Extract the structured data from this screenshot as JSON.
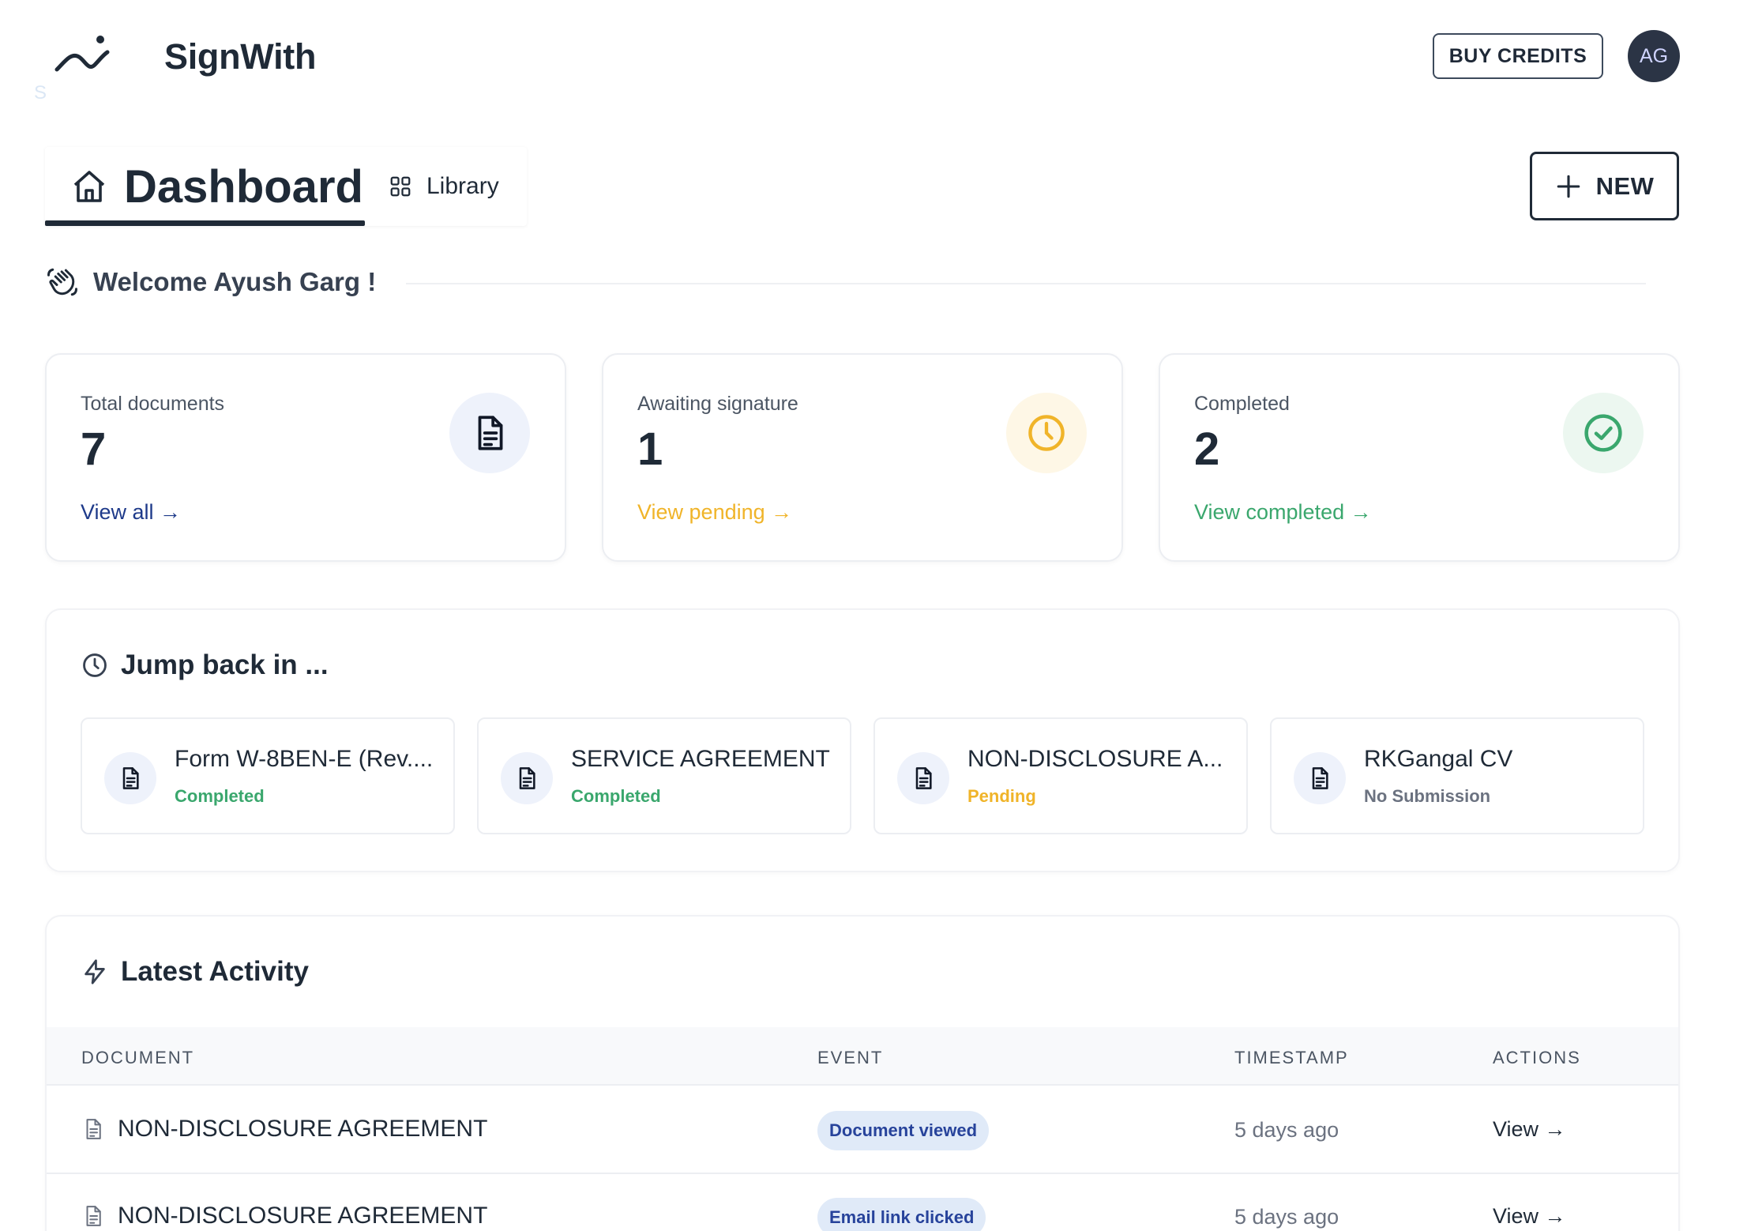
{
  "header": {
    "brand": "SignWith",
    "logo_ghost_letter": "S",
    "buy_credits_label": "BUY CREDITS",
    "avatar_initials": "AG"
  },
  "tabs": [
    {
      "label": "Dashboard",
      "icon": "home-icon",
      "active": true
    },
    {
      "label": "Library",
      "icon": "grid-icon",
      "active": false
    }
  ],
  "new_button_label": "NEW",
  "welcome_text": "Welcome Ayush Garg !",
  "stats": [
    {
      "label": "Total documents",
      "value": "7",
      "link": "View all →",
      "icon": "document-icon",
      "color": "#1e3a8a",
      "bg": "#eef2fb"
    },
    {
      "label": "Awaiting signature",
      "value": "1",
      "link": "View pending →",
      "icon": "clock-icon",
      "color": "#f0b429",
      "bg": "#fef7e6"
    },
    {
      "label": "Completed",
      "value": "2",
      "link": "View completed →",
      "icon": "check-circle-icon",
      "color": "#3aa76d",
      "bg": "#ecf7f0"
    }
  ],
  "jump_back": {
    "title": "Jump back in ...",
    "items": [
      {
        "title": "Form W-8BEN-E (Rev....",
        "status": "Completed",
        "status_color": "#3aa76d"
      },
      {
        "title": "SERVICE AGREEMENT",
        "status": "Completed",
        "status_color": "#3aa76d"
      },
      {
        "title": "NON-DISCLOSURE A...",
        "status": "Pending",
        "status_color": "#f0b429"
      },
      {
        "title": "RKGangal CV",
        "status": "No Submission",
        "status_color": "#6b7280"
      }
    ]
  },
  "activity": {
    "title": "Latest Activity",
    "columns": [
      "DOCUMENT",
      "EVENT",
      "TIMESTAMP",
      "ACTIONS"
    ],
    "rows": [
      {
        "document": "NON-DISCLOSURE AGREEMENT",
        "event": "Document viewed",
        "timestamp": "5 days ago",
        "action": "View →"
      },
      {
        "document": "NON-DISCLOSURE AGREEMENT",
        "event": "Email link clicked",
        "timestamp": "5 days ago",
        "action": "View →"
      }
    ]
  }
}
